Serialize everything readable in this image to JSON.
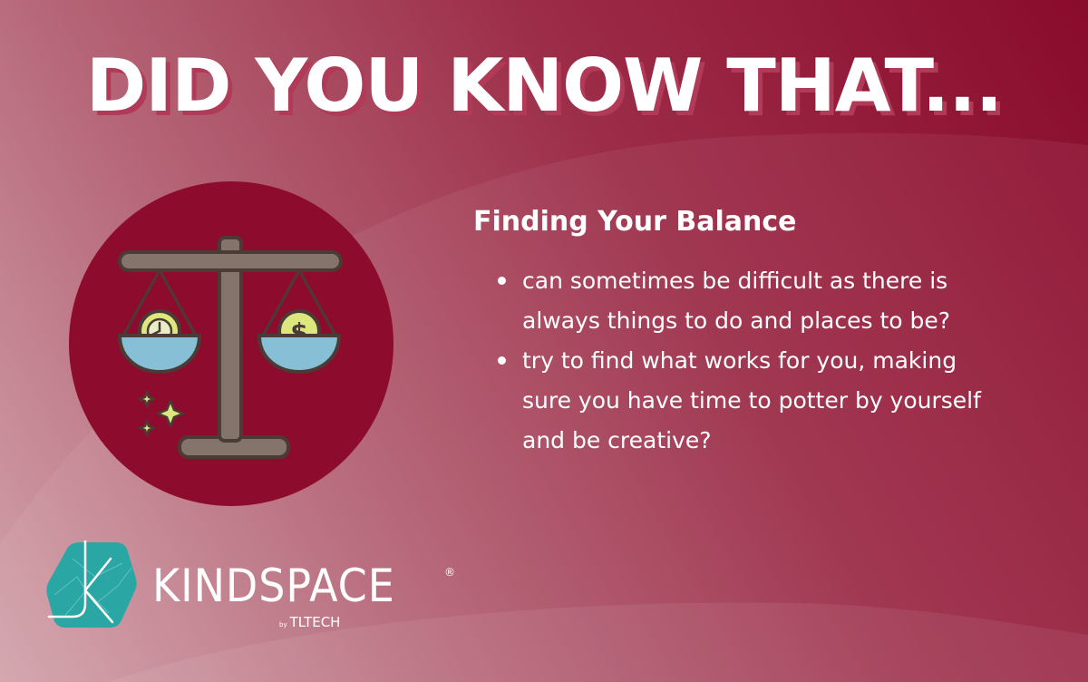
{
  "headline": "DID YOU KNOW THAT...",
  "section": {
    "heading": "Finding Your Balance",
    "bullets": [
      "can sometimes be difficult as there is always things to do and places to be?",
      "try to find what works for you, making sure you have time to potter by yourself and be creative?"
    ]
  },
  "logo": {
    "wordmark": "KINDSPACE",
    "registered": "®",
    "by": "by",
    "maker": "TLTECH"
  },
  "icon": {
    "name": "balance-scale-icon",
    "left_item": "clock-icon",
    "right_item": "dollar-coin-icon",
    "accent": "sparkle-icon"
  },
  "colors": {
    "background_dark": "#8a0b2c",
    "background_light": "#d2a3ab",
    "icon_circle": "#8d0c2e",
    "text": "#ffffff",
    "logo_teal": "#2aa7a4",
    "scale_brown": "#85746b",
    "pan_blue": "#86bfd6",
    "coin_yellow": "#dce87d"
  }
}
